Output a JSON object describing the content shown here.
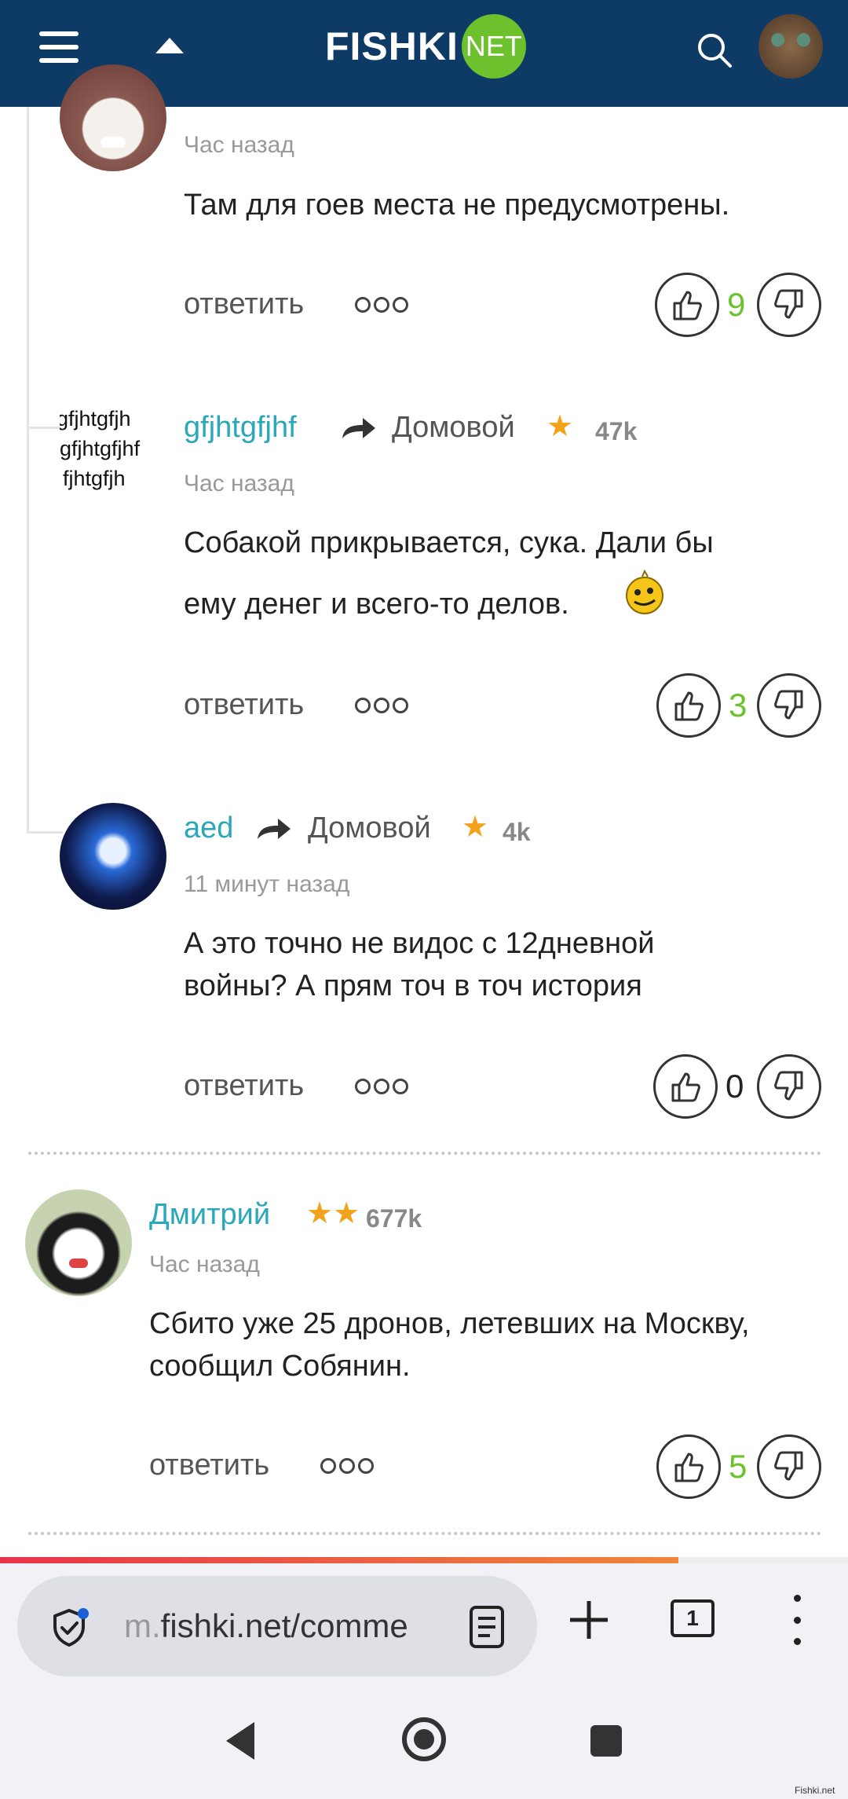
{
  "header": {
    "logo_main": "FISHKI",
    "logo_badge": "NET"
  },
  "comments": [
    {
      "timestamp": "Час назад",
      "text": "Там для гоев места не предусмотрены.",
      "reply_label": "ответить",
      "votes": "9",
      "votes_color": "#6cc12c"
    },
    {
      "username": "gfjhtgfjhf",
      "reply_to": "Домовой",
      "karma": "47k",
      "timestamp": "Час назад",
      "text_line1": "Собакой прикрывается, сука. Дали бы",
      "text_line2": "ему денег и всего-то делов.",
      "avatar_text": [
        "gfjhtgfjh",
        "gfjhtgfjhf",
        "fjhtgfjh"
      ],
      "reply_label": "ответить",
      "votes": "3",
      "votes_color": "#6cc12c"
    },
    {
      "username": "aed",
      "reply_to": "Домовой",
      "karma": "4k",
      "timestamp": "11 минут назад",
      "text_line1": "А это точно не видос с 12дневной",
      "text_line2": "войны? А прям точ в точ история",
      "reply_label": "ответить",
      "votes": "0",
      "votes_color": "#222222"
    },
    {
      "username": "Дмитрий",
      "karma": "677k",
      "timestamp": "Час назад",
      "text_line1": "Сбито уже 25 дронов, летевших на Москву,",
      "text_line2": "сообщил Собянин.",
      "reply_label": "ответить",
      "votes": "5",
      "votes_color": "#6cc12c"
    }
  ],
  "browser": {
    "url_prefix": "m.",
    "url_main": "fishki.net/comme",
    "tabs_count": "1",
    "progress": 0.8
  },
  "watermark": "Fishki.net"
}
